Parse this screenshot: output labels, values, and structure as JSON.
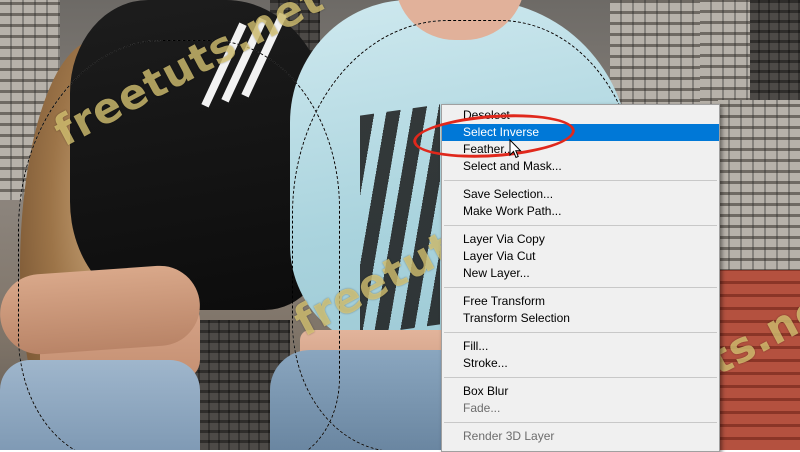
{
  "watermark": {
    "text": "freetuts.net"
  },
  "context_menu": {
    "groups": [
      [
        {
          "label": "Deselect",
          "state": "normal"
        },
        {
          "label": "Select Inverse",
          "state": "highlighted"
        },
        {
          "label": "Feather...",
          "state": "normal"
        },
        {
          "label": "Select and Mask...",
          "state": "normal"
        }
      ],
      [
        {
          "label": "Save Selection...",
          "state": "normal"
        },
        {
          "label": "Make Work Path...",
          "state": "normal"
        }
      ],
      [
        {
          "label": "Layer Via Copy",
          "state": "normal"
        },
        {
          "label": "Layer Via Cut",
          "state": "normal"
        },
        {
          "label": "New Layer...",
          "state": "normal"
        }
      ],
      [
        {
          "label": "Free Transform",
          "state": "normal"
        },
        {
          "label": "Transform Selection",
          "state": "normal"
        }
      ],
      [
        {
          "label": "Fill...",
          "state": "normal"
        },
        {
          "label": "Stroke...",
          "state": "normal"
        }
      ],
      [
        {
          "label": "Box Blur",
          "state": "normal"
        },
        {
          "label": "Fade...",
          "state": "disabled"
        }
      ],
      [
        {
          "label": "Render 3D Layer",
          "state": "disabled"
        }
      ]
    ]
  },
  "colors": {
    "highlight": "#0078d7",
    "annotation": "#e0281c",
    "menu_bg": "#f0f0f0",
    "watermark": "#e1cd78"
  },
  "icons": {
    "cursor": "mouse-pointer-icon"
  }
}
